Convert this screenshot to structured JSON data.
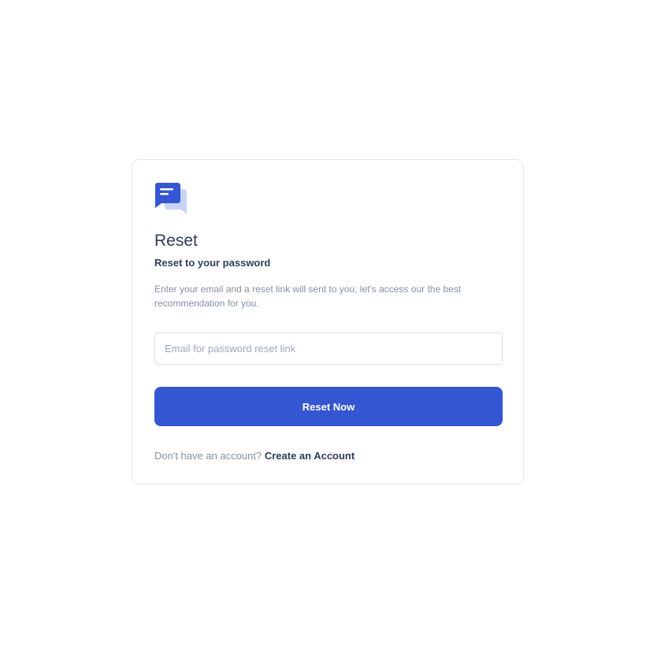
{
  "brand": {
    "logo_icon": "chat-bubbles-icon",
    "primary_color": "#3556d2",
    "secondary_color": "#c9d3f7"
  },
  "header": {
    "title": "Reset",
    "subtitle": "Reset to your password",
    "description": "Enter your email and a reset link will sent to you, let's access our the best recommendation for you."
  },
  "form": {
    "email_value": "",
    "email_placeholder": "Email for password reset link",
    "submit_label": "Reset Now"
  },
  "footer": {
    "prompt": "Don't have an account?",
    "link_label": "Create an Account"
  }
}
